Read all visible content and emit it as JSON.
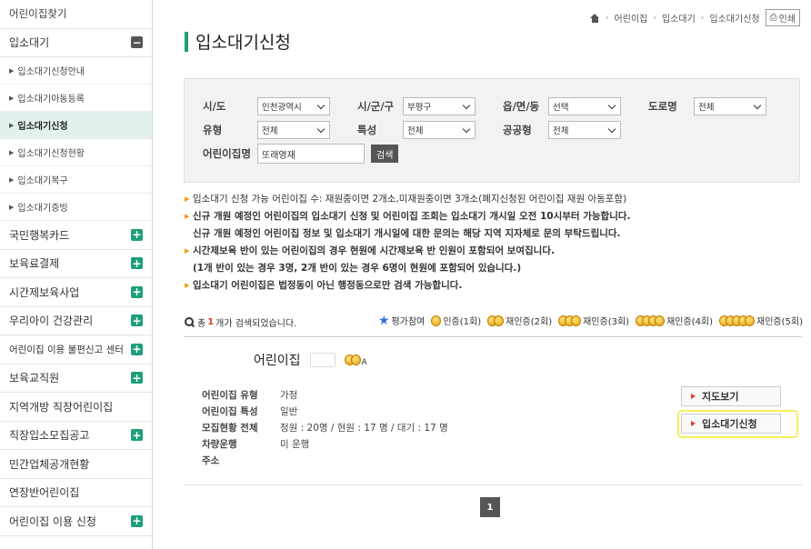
{
  "sidebar": {
    "top_item": "어린이집찾기",
    "section": {
      "label": "입소대기",
      "toggle": "−"
    },
    "sub_items": [
      {
        "label": "입소대기신청안내",
        "active": false
      },
      {
        "label": "입소대기아동등록",
        "active": false
      },
      {
        "label": "입소대기신청",
        "active": true
      },
      {
        "label": "입소대기신청현황",
        "active": false
      },
      {
        "label": "입소대기복구",
        "active": false
      },
      {
        "label": "입소대기증빙",
        "active": false
      }
    ],
    "menu_items": [
      {
        "label": "국민행복카드",
        "toggle": "+"
      },
      {
        "label": "보육료결제",
        "toggle": "+"
      },
      {
        "label": "시간제보육사업",
        "toggle": "+"
      },
      {
        "label": "우리아이 건강관리",
        "toggle": "+"
      },
      {
        "label": "어린이집 이용 불편신고 센터",
        "toggle": "+"
      },
      {
        "label": "보육교직원",
        "toggle": "+"
      },
      {
        "label": "지역개방 직장어린이집",
        "toggle": ""
      },
      {
        "label": "직장입소모집공고",
        "toggle": "+"
      },
      {
        "label": "민간업체공개현황",
        "toggle": ""
      },
      {
        "label": "연장반어린이집",
        "toggle": ""
      },
      {
        "label": "어린이집 이용 신청",
        "toggle": "+"
      }
    ]
  },
  "breadcrumb": {
    "items": [
      "어린이집",
      "입소대기",
      "입소대기신청"
    ],
    "print_label": "인쇄"
  },
  "page_title": "입소대기신청",
  "search": {
    "sido_label": "시/도",
    "sido_value": "인천광역시",
    "sigungu_label": "시/군/구",
    "sigungu_value": "부평구",
    "eupmyeon_label": "읍/면/동",
    "eupmyeon_value": "선택",
    "road_label": "도로명",
    "road_value": "전체",
    "type_label": "유형",
    "type_value": "전체",
    "feature_label": "특성",
    "feature_value": "전체",
    "public_label": "공공형",
    "public_value": "전체",
    "name_label": "어린이집명",
    "name_value": "또래영재",
    "search_button": "검색"
  },
  "notes": [
    {
      "text": "입소대기 신청 가능 어린이집 수: 재원중이면 2개소,미재원중이면 3개소(폐지신청된 어린이집 재원 아동포함)",
      "bold": false,
      "arrow": true
    },
    {
      "text": "신규 개원 예정인 어린이집의 입소대기 신청 및 어린이집 조회는 입소대기 개시일 오전 10시부터 가능합니다.",
      "bold": true,
      "arrow": true
    },
    {
      "text": "신규 개원 예정인 어린이집 정보 및 입소대기 개시일에 대한 문의는 해당 지역 지자체로 문의 부탁드립니다.",
      "bold": true,
      "arrow": false
    },
    {
      "text": "시간제보육 반이 있는 어린이집의 경우 현원에 시간제보육 반 인원이 포함되어 보여집니다.",
      "bold": true,
      "arrow": true
    },
    {
      "text": "(1개 반이 있는 경우 3명, 2개 반이 있는 경우 6명이 현원에 포함되어 있습니다.)",
      "bold": true,
      "arrow": false
    },
    {
      "text": "입소대기 어린이집은 법정동이 아닌 행정동으로만 검색 가능합니다.",
      "bold": true,
      "arrow": true
    }
  ],
  "result": {
    "prefix": "총",
    "count": "1",
    "suffix": "개가 검색되었습니다.",
    "legend": {
      "rating": "평가참여",
      "c1": "인증(1회)",
      "c2": "재인증(2회)",
      "c3": "재인증(3회)",
      "c4": "재인증(4회)",
      "c5": "재인증(5회)"
    }
  },
  "card": {
    "name": "어린이집",
    "grade": "A",
    "rows": [
      {
        "key": "어린이집 유형",
        "value": "가정"
      },
      {
        "key": "어린이집 특성",
        "value": "일반"
      },
      {
        "key": "모집현황 전체",
        "value": "정원 : 20명 / 현원 : 17 명 / 대기 : 17 명"
      },
      {
        "key": "차량운행",
        "value": "미 운행"
      },
      {
        "key": "주소",
        "value": ""
      }
    ],
    "map_button": "지도보기",
    "apply_button": "입소대기신청"
  },
  "pagination": {
    "current": "1"
  },
  "colors": {
    "accent": "#1e9e7a",
    "highlight": "#f4f05b",
    "count": "#e53b2c"
  }
}
